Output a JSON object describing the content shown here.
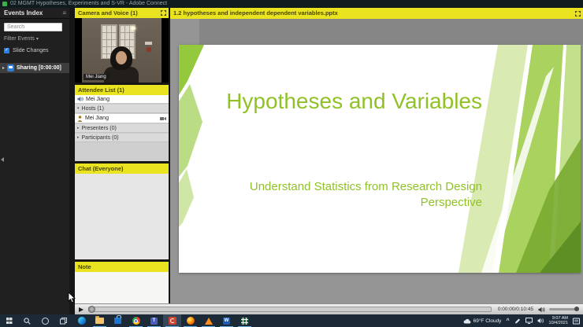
{
  "window": {
    "title": "02 MGMT Hypotheses, Experiments and S-VR - Adobe Connect"
  },
  "sidebar": {
    "title": "Events Index",
    "search_placeholder": "Search",
    "filter_label": "Filter Events",
    "slide_changes_label": "Slide Changes",
    "slide_changes_checked": true,
    "sharing_row": "Sharing [0:00:00]"
  },
  "pods": {
    "camera": {
      "title": "Camera and Voice (1)",
      "name_tag": "Mei Jiang"
    },
    "attendees": {
      "title": "Attendee List (1)",
      "active_speaker": "Mei Jiang",
      "groups": [
        {
          "label": "Hosts (1)",
          "expanded": true,
          "members": [
            "Mei Jiang"
          ]
        },
        {
          "label": "Presenters (0)",
          "expanded": false,
          "members": []
        },
        {
          "label": "Participants (0)",
          "expanded": false,
          "members": []
        }
      ]
    },
    "chat": {
      "title": "Chat (Everyone)"
    },
    "note": {
      "title": "Note"
    },
    "share": {
      "title": "1.2 hypotheses and independent dependent variables.pptx",
      "slide": {
        "title": "Hypotheses and Variables",
        "subtitle": "Understand Statistics from Research Design Perspective",
        "accent_color": "#90c226"
      }
    }
  },
  "playback": {
    "time_display": "0:00:00/0:10:45"
  },
  "taskbar": {
    "weather": "69°F Cloudy",
    "clock": {
      "time": "9:07 AM",
      "date": "10/4/2021"
    },
    "app_icons": [
      "start",
      "search",
      "cortana",
      "task-view",
      "edge",
      "file-explorer",
      "store",
      "chrome",
      "teams",
      "adobe-connect",
      "firefox",
      "vlc",
      "word",
      "excel"
    ],
    "tray_icons": [
      "cloud",
      "caret-up",
      "pen",
      "monitor",
      "speaker",
      "clock",
      "notifications"
    ]
  },
  "colors": {
    "pod_header": "#e9e41f",
    "accent_green": "#90c226",
    "taskbar": "#1c2a38",
    "highlight_row": "#3d3d3d"
  }
}
